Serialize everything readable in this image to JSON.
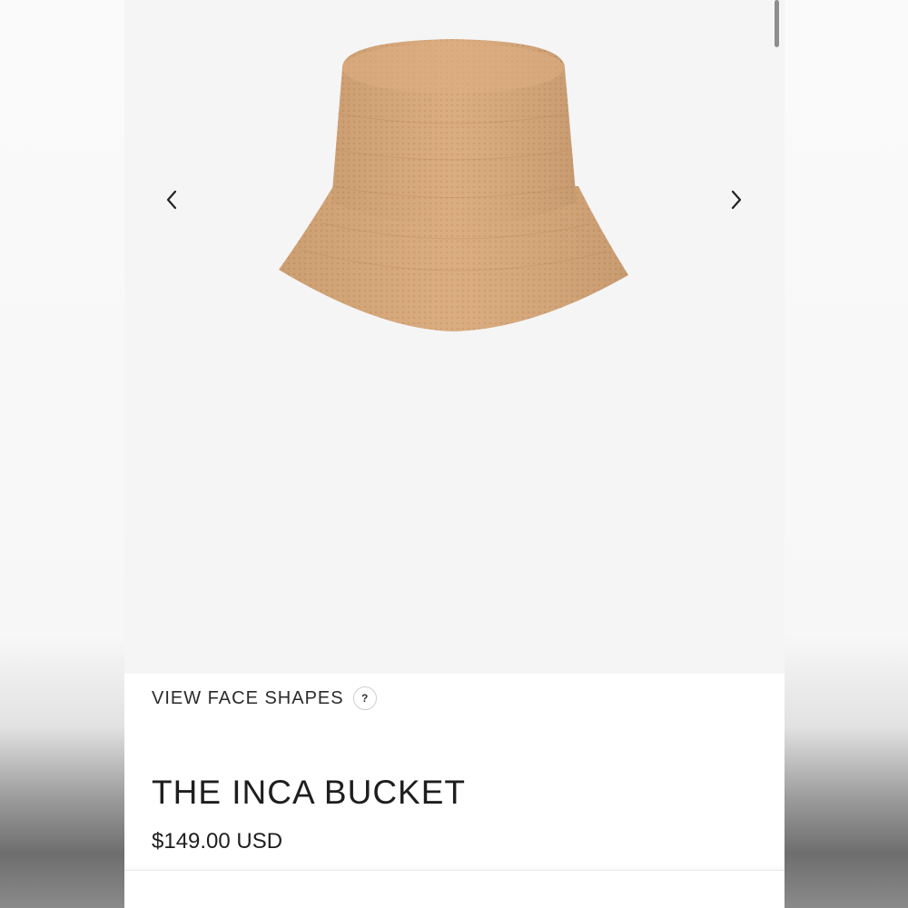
{
  "gallery": {
    "image_alt": "Straw raffia bucket hat",
    "prev_icon": "chevron-left-icon",
    "next_icon": "chevron-right-icon",
    "hat_color": "#d9a97a"
  },
  "face_shapes": {
    "label": "VIEW FACE SHAPES",
    "help_glyph": "?"
  },
  "product": {
    "title": "THE INCA BUCKET",
    "price": "$149.00 USD"
  }
}
